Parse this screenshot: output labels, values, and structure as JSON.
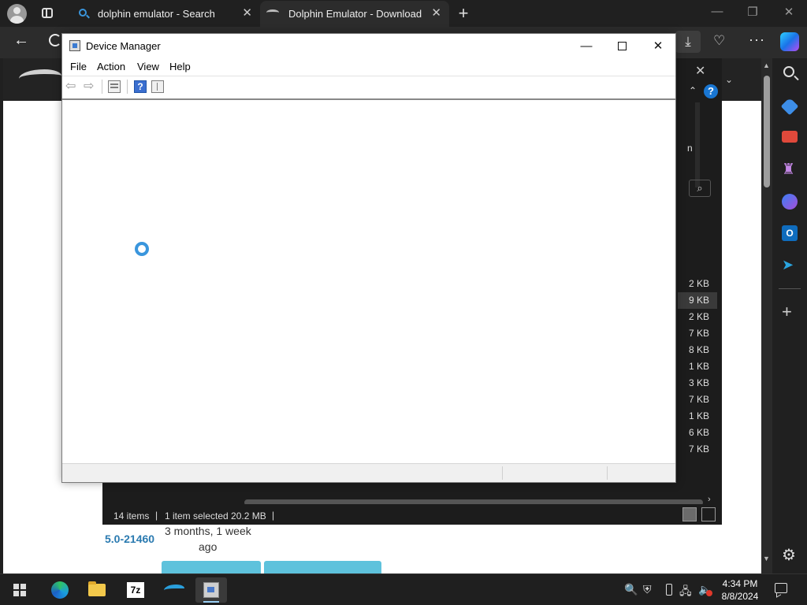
{
  "browser": {
    "tabs": [
      {
        "label": "dolphin emulator - Search",
        "icon": "search-icon"
      },
      {
        "label": "Dolphin Emulator - Download",
        "icon": "dolphin-icon"
      }
    ],
    "new_tab_glyph": "+",
    "close_glyph": "✕",
    "window_controls": {
      "minimize": "—",
      "restore": "❐",
      "close": "✕"
    },
    "nav": {
      "back": "←",
      "download": "⤓",
      "more": "···"
    },
    "sidebar_icons": [
      "search-icon",
      "tag-icon",
      "tools-icon",
      "chess-icon",
      "copilot-icon",
      "outlook-icon",
      "send-icon",
      "add-icon",
      "settings-icon"
    ],
    "sidebar_outlook_glyph": "O",
    "sidebar_chess_glyph": "♜",
    "sidebar_send_glyph": "➤",
    "sidebar_add_glyph": "+",
    "sidebar_gear_glyph": "⚙"
  },
  "webpage": {
    "version": "5.0-21460",
    "age_line1": "3 months, 1 week",
    "age_line2": "ago"
  },
  "explorer": {
    "close_glyph": "✕",
    "expand_glyph": "⌄",
    "up_glyph": "⌃",
    "help_glyph": "?",
    "partial_header": "n",
    "search_glyph": "⌕",
    "file_sizes_partial": [
      "2 KB",
      "9 KB",
      "2 KB",
      "7 KB",
      "8 KB",
      "1 KB",
      "3 KB",
      "7 KB",
      "1 KB",
      "6 KB",
      "7 KB"
    ],
    "status": {
      "items": "14 items",
      "selected": "1 item selected  20.2 MB"
    },
    "scroll_right_glyph": "›"
  },
  "device_manager": {
    "title": "Device Manager",
    "window_controls": {
      "minimize": "—",
      "close": "✕"
    },
    "menu": [
      "File",
      "Action",
      "View",
      "Help"
    ],
    "toolbar": {
      "back": "⇦",
      "forward": "⇨",
      "help": "?"
    }
  },
  "taskbar": {
    "apps": [
      "edge",
      "file-explorer",
      "7-zip",
      "dolphin-emulator",
      "device-manager"
    ],
    "seven_zip_label": "7z",
    "tray": {
      "search": "🔍",
      "shield": "⛨",
      "network": "🖧",
      "volume": "🔈"
    },
    "time": "4:34 PM",
    "date": "8/8/2024"
  }
}
